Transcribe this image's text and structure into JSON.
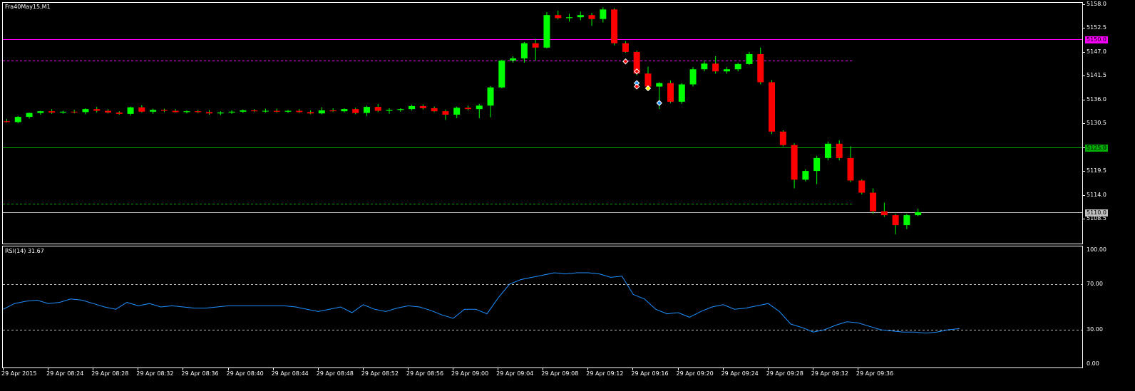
{
  "window": {
    "symbol_label": "Fra40May15,M1",
    "indicator_label": "RSI(14) 31.67"
  },
  "colors": {
    "background": "#000000",
    "bull": "#00ff00",
    "bear": "#ff0000",
    "wick": "#00ff00",
    "rsi_line": "#1e90ff",
    "level_magenta": "#ff00ff",
    "level_green": "#00aa00",
    "bid_line": "#c0c0c0",
    "axis": "#ffffff"
  },
  "chart_data": [
    {
      "type": "candlestick",
      "name": "main",
      "symbol": "Fra40May15",
      "timeframe": "M1",
      "y_range": [
        5104.0,
        5158.0
      ],
      "y_ticks": [
        "5158.0",
        "5152.5",
        "5147.0",
        "5141.5",
        "5136.0",
        "5130.5",
        "5125.0",
        "5119.5",
        "5114.0",
        "5108.5"
      ],
      "x_ticks": [
        "29 Apr 2015",
        "29 Apr 08:24",
        "29 Apr 08:28",
        "29 Apr 08:32",
        "29 Apr 08:36",
        "29 Apr 08:40",
        "29 Apr 08:44",
        "29 Apr 08:48",
        "29 Apr 08:52",
        "29 Apr 08:56",
        "29 Apr 09:00",
        "29 Apr 09:04",
        "29 Apr 09:08",
        "29 Apr 09:12",
        "29 Apr 09:16",
        "29 Apr 09:20",
        "29 Apr 09:24",
        "29 Apr 09:28",
        "29 Apr 09:32",
        "29 Apr 09:36"
      ],
      "candles": [
        [
          5131.0,
          5131.5,
          5130.7,
          5130.8
        ],
        [
          5130.8,
          5132.2,
          5130.5,
          5132.0
        ],
        [
          5132.0,
          5133.0,
          5131.6,
          5132.9
        ],
        [
          5132.9,
          5133.4,
          5132.5,
          5133.3
        ],
        [
          5133.3,
          5133.8,
          5132.7,
          5133.0
        ],
        [
          5133.0,
          5133.4,
          5132.7,
          5133.2
        ],
        [
          5133.2,
          5133.6,
          5132.8,
          5133.1
        ],
        [
          5133.1,
          5134.0,
          5132.6,
          5133.8
        ],
        [
          5133.8,
          5134.3,
          5133.0,
          5133.4
        ],
        [
          5133.4,
          5133.8,
          5132.8,
          5133.0
        ],
        [
          5133.0,
          5133.3,
          5132.5,
          5132.7
        ],
        [
          5132.7,
          5134.4,
          5132.3,
          5134.2
        ],
        [
          5134.2,
          5134.7,
          5133.0,
          5133.2
        ],
        [
          5133.2,
          5133.9,
          5132.7,
          5133.6
        ],
        [
          5133.6,
          5133.9,
          5133.1,
          5133.4
        ],
        [
          5133.4,
          5133.8,
          5133.0,
          5133.1
        ],
        [
          5133.1,
          5133.5,
          5132.8,
          5133.3
        ],
        [
          5133.3,
          5133.6,
          5132.9,
          5133.1
        ],
        [
          5133.1,
          5133.6,
          5132.5,
          5132.8
        ],
        [
          5132.8,
          5133.3,
          5132.4,
          5133.0
        ],
        [
          5133.0,
          5133.5,
          5132.7,
          5133.2
        ],
        [
          5133.2,
          5133.7,
          5132.9,
          5133.5
        ],
        [
          5133.5,
          5133.8,
          5133.1,
          5133.3
        ],
        [
          5133.3,
          5133.9,
          5133.0,
          5133.4
        ],
        [
          5133.4,
          5133.9,
          5133.0,
          5133.2
        ],
        [
          5133.2,
          5133.6,
          5132.9,
          5133.4
        ],
        [
          5133.4,
          5133.8,
          5132.9,
          5133.1
        ],
        [
          5133.1,
          5133.5,
          5132.6,
          5132.8
        ],
        [
          5132.8,
          5134.2,
          5132.6,
          5133.5
        ],
        [
          5133.5,
          5134.0,
          5133.1,
          5133.3
        ],
        [
          5133.3,
          5134.0,
          5133.0,
          5133.8
        ],
        [
          5133.8,
          5134.1,
          5132.6,
          5132.9
        ],
        [
          5132.9,
          5134.6,
          5132.2,
          5134.3
        ],
        [
          5134.3,
          5135.0,
          5133.1,
          5133.4
        ],
        [
          5133.4,
          5134.0,
          5132.7,
          5133.6
        ],
        [
          5133.6,
          5134.0,
          5133.2,
          5133.8
        ],
        [
          5133.8,
          5134.8,
          5133.5,
          5134.5
        ],
        [
          5134.5,
          5134.9,
          5133.7,
          5134.0
        ],
        [
          5134.0,
          5134.4,
          5133.1,
          5133.3
        ],
        [
          5133.3,
          5133.7,
          5131.3,
          5132.5
        ],
        [
          5132.5,
          5134.4,
          5131.7,
          5134.1
        ],
        [
          5134.1,
          5134.6,
          5133.5,
          5133.8
        ],
        [
          5133.8,
          5135.0,
          5131.7,
          5134.6
        ],
        [
          5134.6,
          5139.1,
          5131.9,
          5138.8
        ],
        [
          5138.8,
          5145.2,
          5138.6,
          5145.0
        ],
        [
          5145.0,
          5146.0,
          5144.5,
          5145.5
        ],
        [
          5145.5,
          5149.3,
          5144.5,
          5149.0
        ],
        [
          5149.0,
          5150.0,
          5145.0,
          5148.0
        ],
        [
          5148.0,
          5156.2,
          5147.8,
          5155.5
        ],
        [
          5155.5,
          5156.5,
          5154.5,
          5154.8
        ],
        [
          5154.8,
          5155.8,
          5154.0,
          5155.0
        ],
        [
          5155.0,
          5156.3,
          5154.3,
          5155.5
        ],
        [
          5155.5,
          5156.0,
          5153.0,
          5154.6
        ],
        [
          5154.6,
          5157.3,
          5153.8,
          5156.8
        ],
        [
          5156.8,
          5157.1,
          5148.5,
          5149.0
        ],
        [
          5149.0,
          5149.5,
          5146.8,
          5147.0
        ],
        [
          5147.0,
          5147.3,
          5141.6,
          5142.0
        ],
        [
          5142.0,
          5143.6,
          5138.6,
          5139.0
        ],
        [
          5139.0,
          5140.0,
          5133.8,
          5139.8
        ],
        [
          5139.8,
          5140.4,
          5135.2,
          5135.5
        ],
        [
          5135.5,
          5139.8,
          5135.0,
          5139.5
        ],
        [
          5139.5,
          5143.5,
          5139.0,
          5143.0
        ],
        [
          5143.0,
          5145.0,
          5142.5,
          5144.3
        ],
        [
          5144.3,
          5146.0,
          5142.0,
          5142.5
        ],
        [
          5142.5,
          5143.5,
          5142.0,
          5143.0
        ],
        [
          5143.0,
          5144.5,
          5142.5,
          5144.2
        ],
        [
          5144.2,
          5147.0,
          5144.0,
          5146.5
        ],
        [
          5146.5,
          5148.0,
          5139.5,
          5140.0
        ],
        [
          5140.0,
          5140.5,
          5128.0,
          5128.6
        ],
        [
          5128.6,
          5128.9,
          5125.2,
          5125.5
        ],
        [
          5125.5,
          5125.9,
          5115.5,
          5117.5
        ],
        [
          5117.5,
          5119.9,
          5117.1,
          5119.5
        ],
        [
          5119.5,
          5123.0,
          5116.5,
          5122.5
        ],
        [
          5122.5,
          5126.3,
          5122.0,
          5125.8
        ],
        [
          5125.8,
          5126.6,
          5122.0,
          5122.5
        ],
        [
          5122.5,
          5125.2,
          5116.9,
          5117.3
        ],
        [
          5117.3,
          5117.6,
          5114.1,
          5114.5
        ],
        [
          5114.5,
          5115.5,
          5109.6,
          5110.2
        ],
        [
          5110.2,
          5112.2,
          5108.9,
          5109.3
        ],
        [
          5109.3,
          5109.6,
          5104.9,
          5107.0
        ],
        [
          5107.0,
          5109.6,
          5106.1,
          5109.3
        ],
        [
          5109.3,
          5110.8,
          5109.1,
          5110.0
        ]
      ],
      "levels": [
        {
          "value": 5150.0,
          "label": "5150.0",
          "style": "solid",
          "color": "#ff00ff"
        },
        {
          "value": 5145.0,
          "label": "",
          "style": "dashed",
          "color": "#ff00ff"
        },
        {
          "value": 5125.0,
          "label": "5125.0",
          "style": "solid",
          "color": "#00aa00"
        },
        {
          "value": 5112.0,
          "label": "",
          "style": "dashed",
          "color": "#00aa00"
        },
        {
          "value": 5110.0,
          "label": "5110.0",
          "style": "solid",
          "color": "#c0c0c0"
        }
      ],
      "trade_markers": [
        {
          "index": 55,
          "price": 5144.8,
          "kind": "sell"
        },
        {
          "index": 56,
          "price": 5142.5,
          "kind": "sell"
        },
        {
          "index": 56,
          "price": 5139.8,
          "kind": "buy"
        },
        {
          "index": 56,
          "price": 5139.0,
          "kind": "sell"
        },
        {
          "index": 57,
          "price": 5138.6,
          "kind": "close"
        },
        {
          "index": 58,
          "price": 5135.2,
          "kind": "buy"
        }
      ]
    },
    {
      "type": "line",
      "name": "RSI(14)",
      "y_range": [
        0,
        100
      ],
      "y_ticks": [
        "100.00",
        "70.00",
        "30.00",
        "0.00"
      ],
      "levels": [
        70,
        30
      ],
      "values": [
        48,
        53,
        55,
        56,
        53,
        54,
        57,
        56,
        53,
        50,
        48,
        54,
        51,
        53,
        50,
        51,
        50,
        49,
        49,
        50,
        51,
        51,
        51,
        51,
        51,
        51,
        50,
        48,
        46,
        48,
        50,
        45,
        52,
        48,
        46,
        49,
        51,
        50,
        47,
        43,
        40,
        48,
        48,
        44,
        58,
        70,
        74,
        76,
        78,
        80,
        79,
        80,
        80,
        79,
        76,
        77,
        61,
        57,
        48,
        44,
        45,
        41,
        46,
        50,
        52,
        48,
        49,
        51,
        53,
        46,
        35,
        32,
        28,
        30,
        34,
        37,
        36,
        33,
        30,
        29,
        28,
        28,
        27,
        28,
        30,
        31
      ]
    }
  ]
}
